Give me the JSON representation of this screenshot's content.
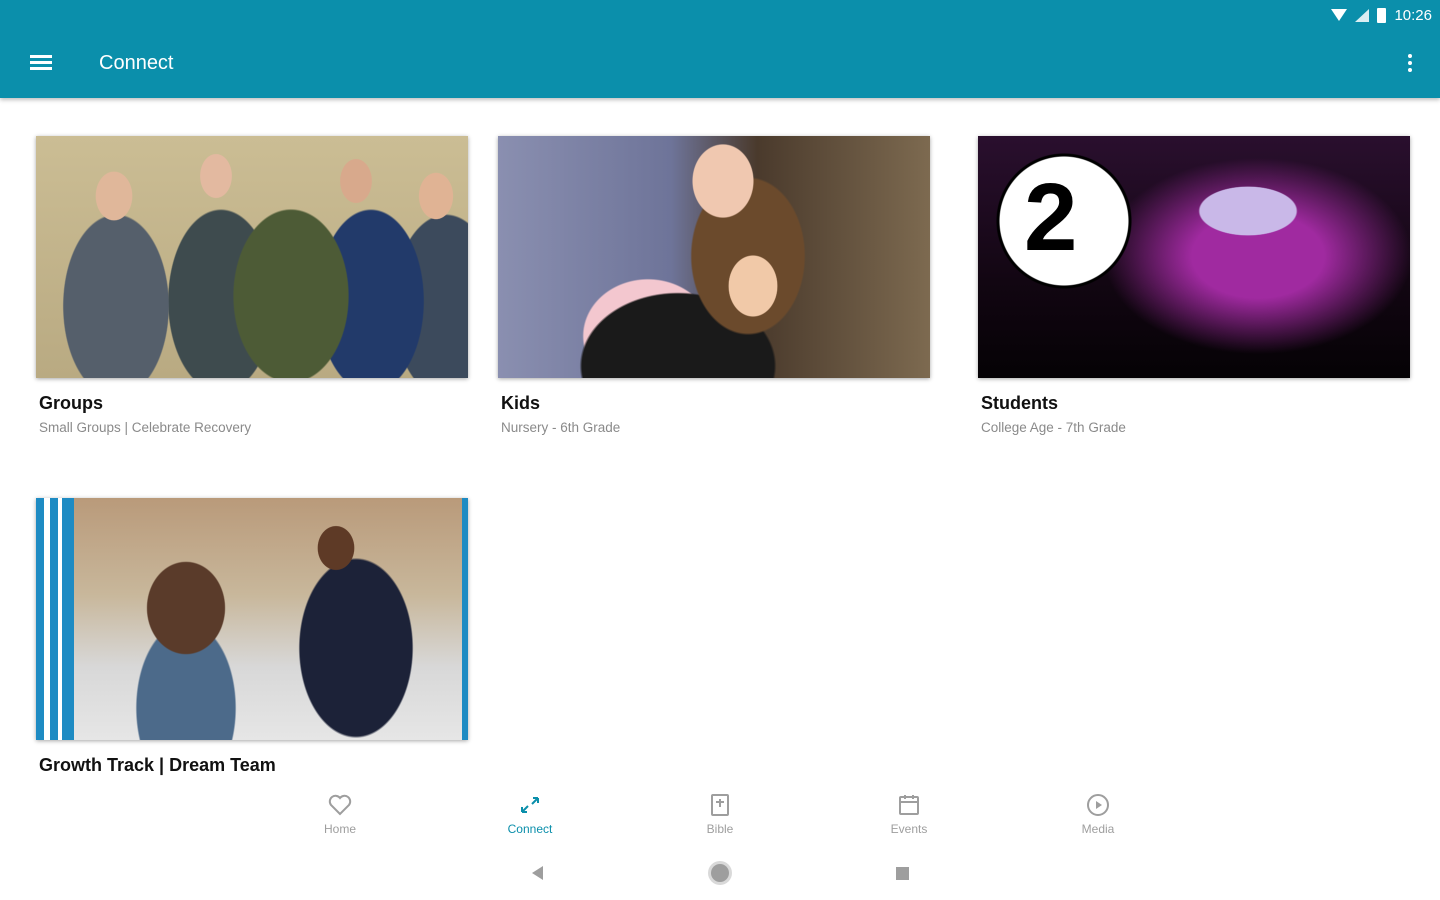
{
  "status_bar": {
    "time": "10:26"
  },
  "app_bar": {
    "title": "Connect"
  },
  "cards": [
    {
      "title": "Groups",
      "subtitle": "Small Groups | Celebrate Recovery"
    },
    {
      "title": "Kids",
      "subtitle": "Nursery - 6th Grade"
    },
    {
      "title": "Students",
      "subtitle": "College Age - 7th Grade",
      "logo_text": "2"
    },
    {
      "title": "Growth Track | Dream Team",
      "subtitle": ""
    }
  ],
  "bottom_nav": [
    {
      "label": "Home",
      "icon": "heart-icon"
    },
    {
      "label": "Connect",
      "icon": "connect-icon",
      "active": true
    },
    {
      "label": "Bible",
      "icon": "bible-icon"
    },
    {
      "label": "Events",
      "icon": "calendar-icon"
    },
    {
      "label": "Media",
      "icon": "play-icon"
    }
  ],
  "colors": {
    "primary": "#0b8fab",
    "inactive": "#9e9e9e"
  }
}
